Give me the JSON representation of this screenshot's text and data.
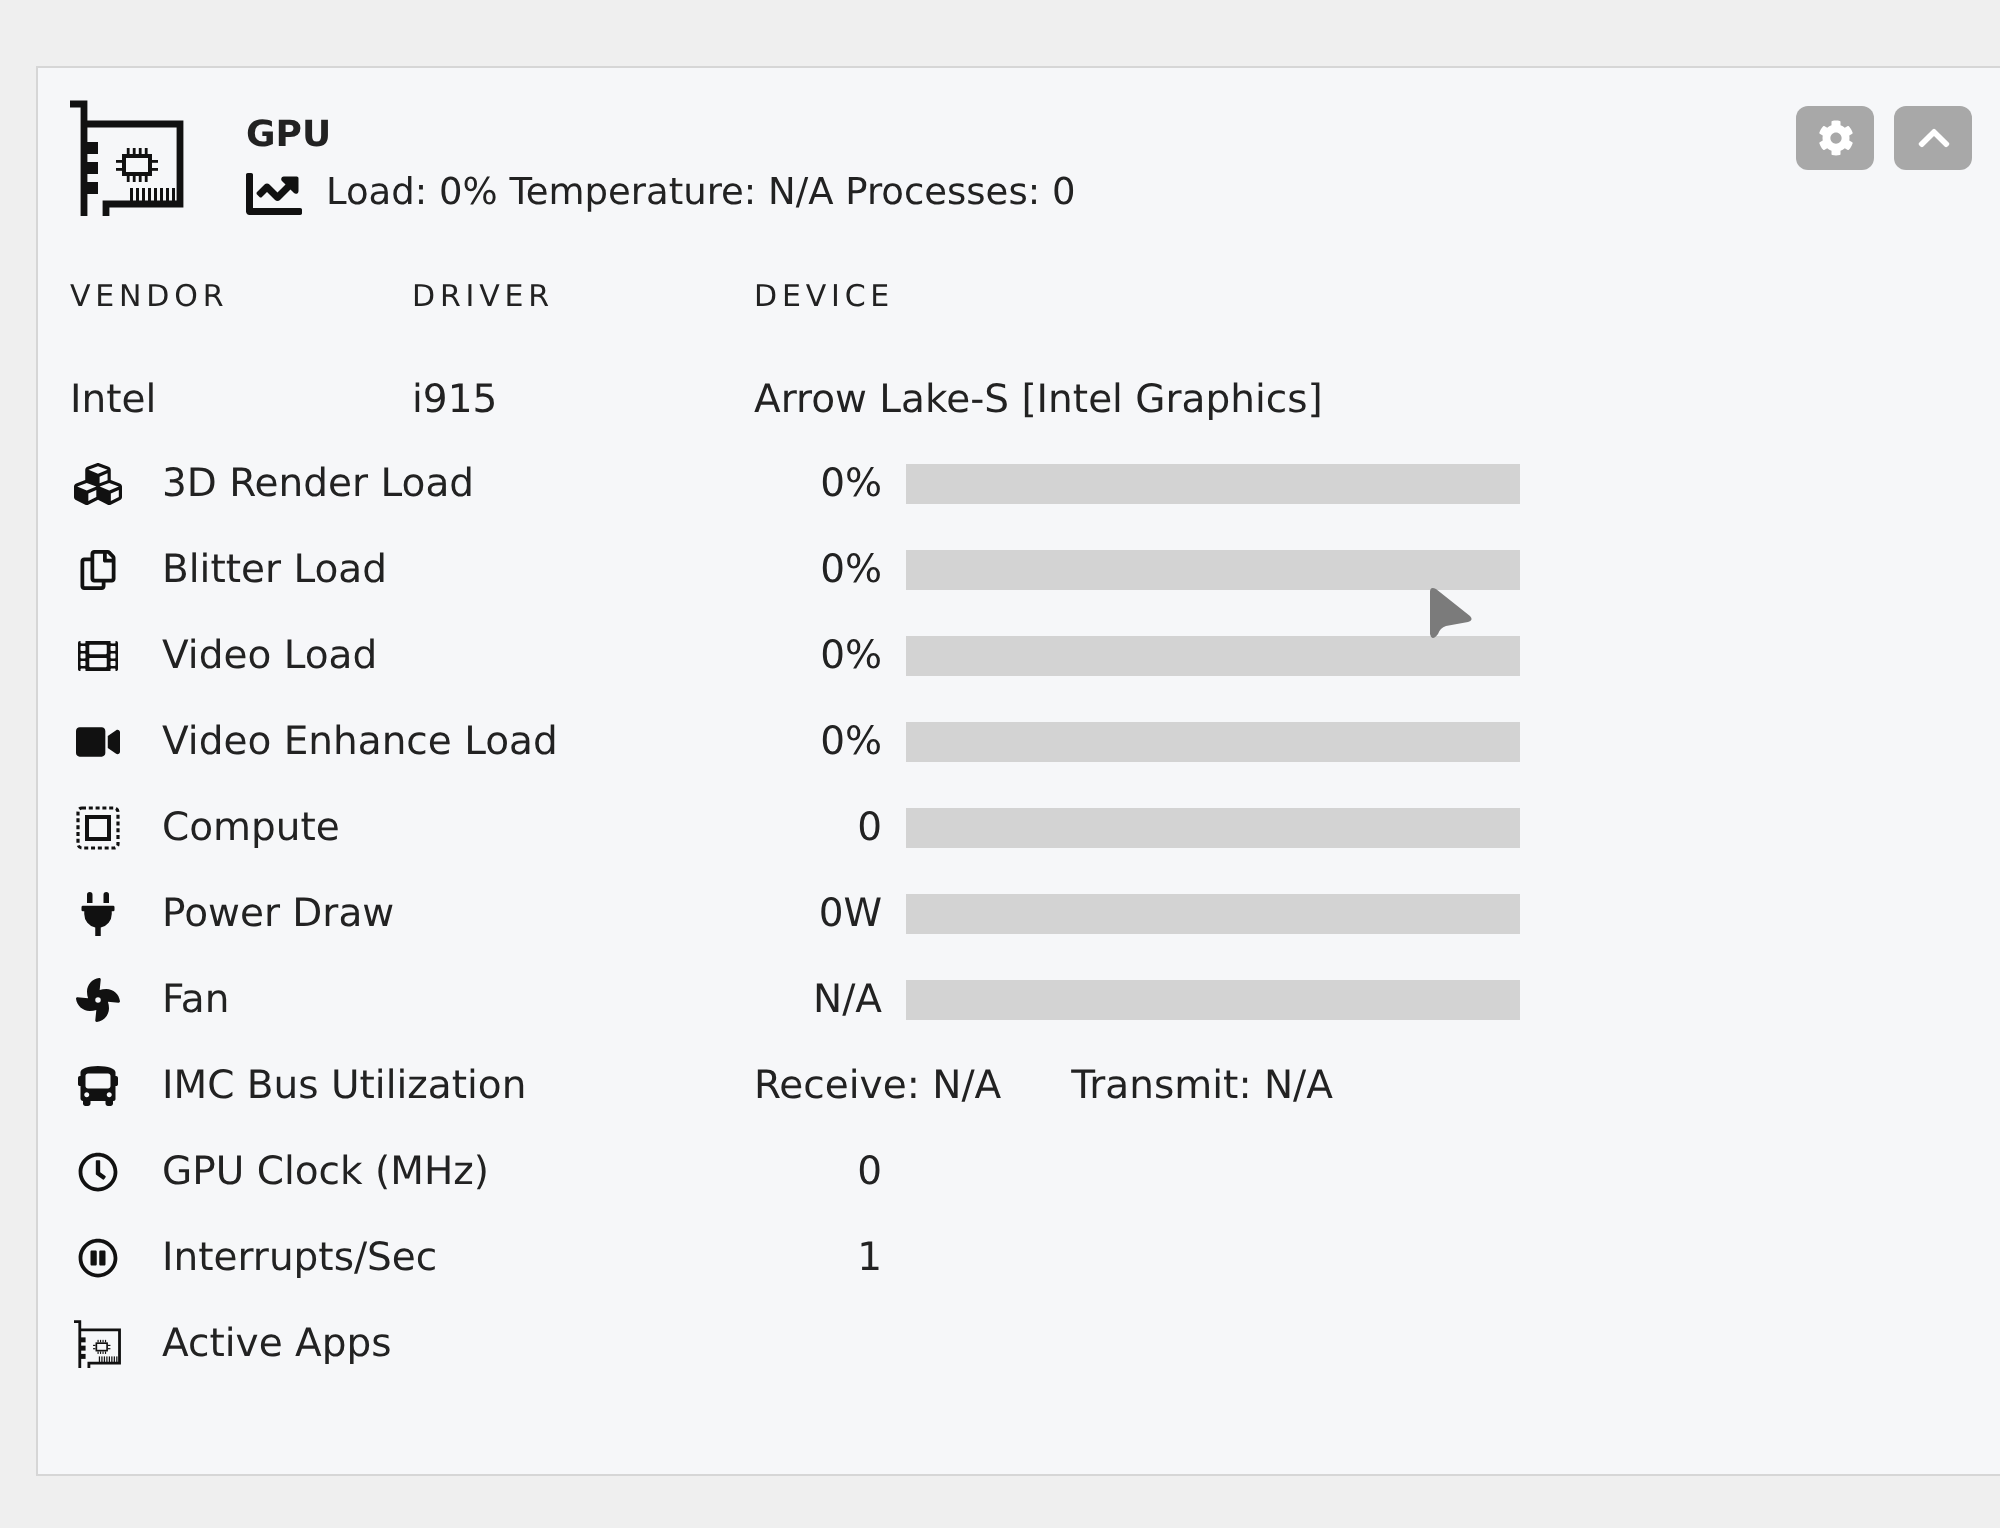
{
  "card": {
    "title": "GPU",
    "summary": "Load: 0% Temperature: N/A Processes: 0"
  },
  "device_table": {
    "columns": [
      "VENDOR",
      "DRIVER",
      "DEVICE"
    ],
    "row": [
      "Intel",
      "i915",
      "Arrow Lake-S [Intel Graphics]"
    ]
  },
  "metrics": [
    {
      "kind": "bar",
      "label": "3D Render Load",
      "value": "0%",
      "level": 0
    },
    {
      "kind": "bar",
      "label": "Blitter Load",
      "value": "0%",
      "level": 0
    },
    {
      "kind": "bar",
      "label": "Video Load",
      "value": "0%",
      "level": 0
    },
    {
      "kind": "bar",
      "label": "Video Enhance Load",
      "value": "0%",
      "level": 0
    },
    {
      "kind": "bar",
      "label": "Compute",
      "value": "0",
      "level": 0
    },
    {
      "kind": "bar",
      "label": "Power Draw",
      "value": "0W",
      "level": 0
    },
    {
      "kind": "bar",
      "label": "Fan",
      "value": "N/A",
      "level": 0
    },
    {
      "kind": "split",
      "label": "IMC Bus Utilization",
      "values": [
        "Receive: N/A",
        "Transmit: N/A"
      ]
    },
    {
      "kind": "value",
      "label": "GPU Clock (MHz)",
      "value": "0"
    },
    {
      "kind": "value",
      "label": "Interrupts/Sec",
      "value": "1"
    },
    {
      "kind": "label",
      "label": "Active Apps"
    }
  ]
}
